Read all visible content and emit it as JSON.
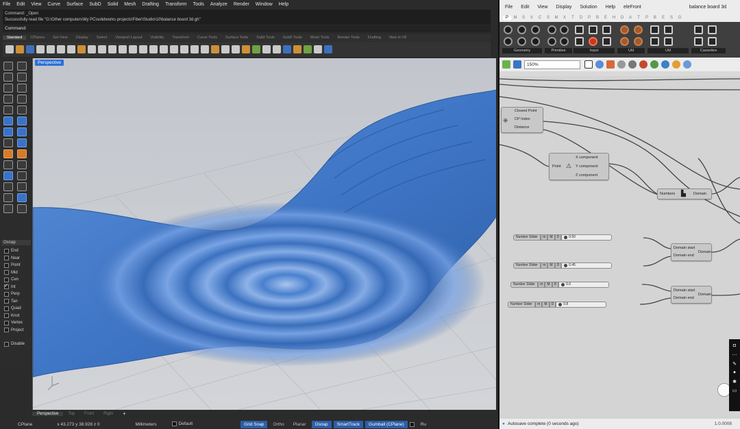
{
  "rhino": {
    "menu": [
      "File",
      "Edit",
      "View",
      "Curve",
      "Surface",
      "SubD",
      "Solid",
      "Mesh",
      "Drafting",
      "Transform",
      "Tools",
      "Analyze",
      "Render",
      "Window",
      "Help"
    ],
    "command_history": [
      "Command: _Open",
      "Successfully read file \"G:\\Other computers\\My PC\\solidworks projects\\Fiber\\Studio\\10\\balance board 3d.gh\""
    ],
    "command_prompt": "Command:",
    "toolbar_tabs": [
      "Standard",
      "CPlanes",
      "Set View",
      "Display",
      "Select",
      "Viewport Layout",
      "Visibility",
      "Transform",
      "Curve Tools",
      "Surface Tools",
      "Solid Tools",
      "SubD Tools",
      "Mesh Tools",
      "Render Tools",
      "Drafting",
      "New in V8"
    ],
    "viewport_label": "Perspective",
    "viewport_tabs": [
      "Perspective",
      "Top",
      "Front",
      "Right"
    ],
    "osnap": {
      "header": "Osnap",
      "items": [
        {
          "label": "End",
          "checked": false
        },
        {
          "label": "Near",
          "checked": false
        },
        {
          "label": "Point",
          "checked": false
        },
        {
          "label": "Mid",
          "checked": false
        },
        {
          "label": "Cen",
          "checked": false
        },
        {
          "label": "Int",
          "checked": true
        },
        {
          "label": "Perp",
          "checked": false
        },
        {
          "label": "Tan",
          "checked": false
        },
        {
          "label": "Quad",
          "checked": false
        },
        {
          "label": "Knot",
          "checked": false
        },
        {
          "label": "Vertex",
          "checked": false
        },
        {
          "label": "Project",
          "checked": false
        }
      ],
      "disable": "Disable"
    },
    "status": {
      "cplane": "CPlane",
      "coords": "x 43.273   y 38.928   z 0",
      "units": "Millimeters",
      "layer": "Default",
      "grid_snap": "Grid Snap",
      "ortho": "Ortho",
      "planar": "Planar",
      "osnap": "Osnap",
      "smarttrack": "SmartTrack",
      "gumball": "Gumball (CPlane)",
      "tail": "Ru"
    }
  },
  "gh": {
    "menu": [
      "File",
      "Edit",
      "View",
      "Display",
      "Solution",
      "Help",
      "eleFront"
    ],
    "document": "balance board 3d",
    "categories": [
      "P",
      "M",
      "S",
      "V",
      "C",
      "S",
      "M",
      "X",
      "T",
      "D",
      "P",
      "B",
      "E",
      "H",
      "D",
      "A",
      "T",
      "P",
      "B",
      "E",
      "S",
      "G"
    ],
    "ribbon_groups": [
      "Geometry",
      "Primitive",
      "Input",
      "Util"
    ],
    "ribbon_groups_extra": [
      "Util",
      "Cassettes"
    ],
    "zoom": "150%",
    "components": {
      "closest_point": {
        "inputs": [
          "Closest Point",
          "CP Index",
          "Distance"
        ]
      },
      "deconstruct": {
        "input": "Point",
        "outputs": [
          "X component",
          "Y component",
          "Z component"
        ]
      },
      "bounds": {
        "input": "Numbers",
        "output": "Domain"
      },
      "domain1": {
        "inputs": [
          "Domain start",
          "Domain end"
        ],
        "output": "Domain"
      },
      "domain2": {
        "inputs": [
          "Domain start",
          "Domain end"
        ],
        "output": "Domain"
      }
    },
    "sliders": [
      {
        "label": "Number Slider",
        "value": "0.50"
      },
      {
        "label": "Number Slider",
        "value": "0.45"
      },
      {
        "label": "Number Slider",
        "value": "0.6"
      },
      {
        "label": "Number Slider",
        "value": "0.8"
      }
    ],
    "slider_controls": [
      "rn",
      "M",
      "D"
    ],
    "status": "Autosave complete (0 seconds ago)",
    "version": "1.0.0008"
  }
}
